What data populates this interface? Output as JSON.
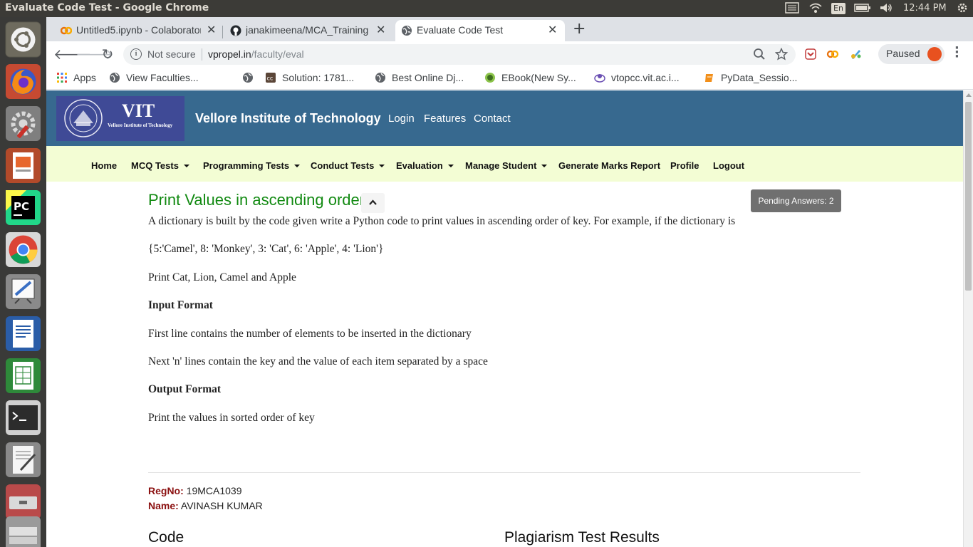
{
  "os": {
    "window_title": "Evaluate Code Test - Google Chrome",
    "keyboard": "En",
    "clock": "12:44 PM"
  },
  "launcher": {
    "items": [
      "ubuntu-dash-icon",
      "firefox-icon",
      "system-settings-icon",
      "impress-icon",
      "pycharm-icon",
      "chrome-icon",
      "drawing-icon",
      "writer-icon",
      "calc-icon",
      "terminal-icon",
      "text-editor-icon",
      "usb-drive-icon",
      "scanner-icon"
    ]
  },
  "browser": {
    "tabs": [
      {
        "title": "Untitled5.ipynb - Colaboratory",
        "favicon": "colab-icon"
      },
      {
        "title": "janakimeena/MCA_Training",
        "favicon": "github-icon"
      },
      {
        "title": "Evaluate Code Test",
        "favicon": "globe-icon"
      }
    ],
    "address": {
      "security": "Not secure",
      "host": "vpropel.in",
      "path": "/faculty/eval"
    },
    "profile_status": "Paused",
    "bookmarks": [
      {
        "label": "Apps",
        "icon": "apps-grid-icon"
      },
      {
        "label": "View Faculties...",
        "icon": "globe-icon"
      },
      {
        "label": "",
        "icon": "globe-icon"
      },
      {
        "label": "Solution: 1781...",
        "icon": "codechef-icon"
      },
      {
        "label": "Best Online Dj...",
        "icon": "globe-icon"
      },
      {
        "label": "EBook(New Sy...",
        "icon": "ebook-icon"
      },
      {
        "label": "vtopcc.vit.ac.i...",
        "icon": "vtop-icon"
      },
      {
        "label": "PyData_Sessio...",
        "icon": "notebook-icon"
      }
    ]
  },
  "site": {
    "logo_text": "VIT",
    "logo_subtitle": "Vellore Institute of Technology",
    "title": "Vellore Institute of Technology",
    "header_links": [
      "Login",
      "Features",
      "Contact"
    ],
    "nav": [
      {
        "label": "Home",
        "dropdown": false
      },
      {
        "label": "MCQ Tests",
        "dropdown": true
      },
      {
        "label": "Programming Tests",
        "dropdown": true
      },
      {
        "label": "Conduct Tests",
        "dropdown": true
      },
      {
        "label": "Evaluation",
        "dropdown": true
      },
      {
        "label": "Manage Student",
        "dropdown": true
      },
      {
        "label": "Generate Marks Report",
        "dropdown": false
      },
      {
        "label": "Profile",
        "dropdown": false
      },
      {
        "label": "Logout",
        "dropdown": false
      }
    ]
  },
  "question": {
    "title": "Print Values in ascending order",
    "pending": "Pending Answers: 2",
    "paragraphs": [
      "A dictionary is built by the code given write a Python code to print values in ascending order of key. For example, if the dictionary is",
      "{5:'Camel', 8: 'Monkey', 3: 'Cat', 6: 'Apple', 4: 'Lion'}",
      "Print Cat, Lion, Camel and Apple",
      "Input Format",
      "First line contains the number of elements to be inserted in the dictionary",
      "Next 'n' lines contain the key and the value of each item separated by a space",
      "Output Format",
      "Print the values in sorted order of key"
    ]
  },
  "student": {
    "regno_label": "RegNo:",
    "regno": "19MCA1039",
    "name_label": "Name:",
    "name": "AVINASH KUMAR"
  },
  "sections": {
    "code": "Code",
    "plagiarism": "Plagiarism Test Results"
  }
}
